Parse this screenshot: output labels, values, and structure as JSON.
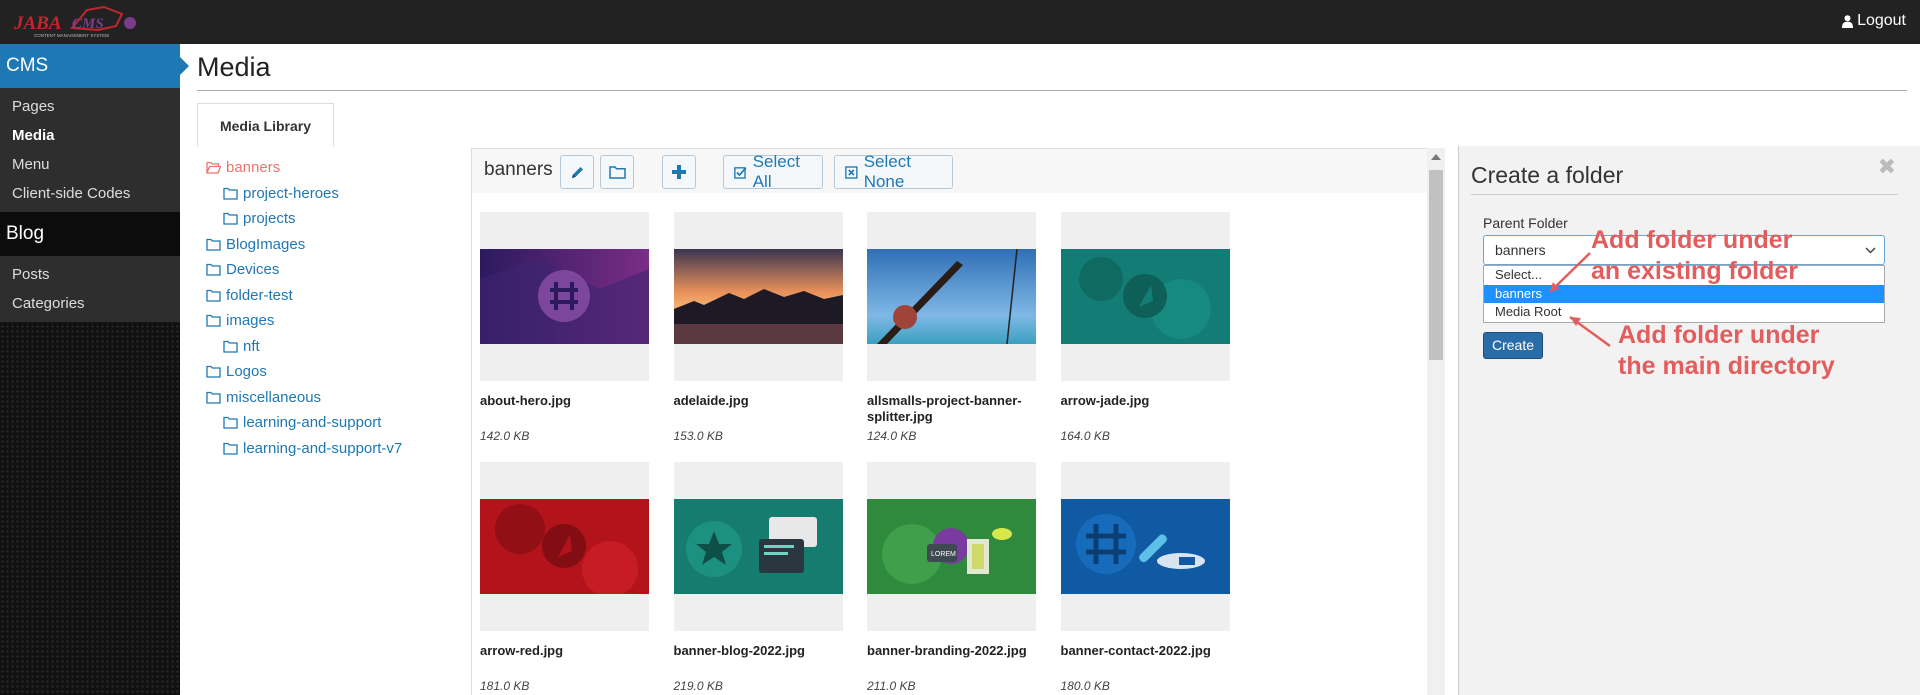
{
  "topbar": {
    "logo_text": "JABA CMS",
    "logo_subtext": "CONTENT MANAGEMENT SYSTEM",
    "logout_label": "Logout"
  },
  "sidebar": {
    "cms_header": "CMS",
    "cms_items": [
      {
        "label": "Pages"
      },
      {
        "label": "Media"
      },
      {
        "label": "Menu"
      },
      {
        "label": "Client-side Codes"
      }
    ],
    "blog_header": "Blog",
    "blog_items": [
      {
        "label": "Posts"
      },
      {
        "label": "Categories"
      }
    ]
  },
  "page": {
    "title": "Media",
    "tab_label": "Media Library"
  },
  "tree": [
    {
      "label": "banners",
      "level": 0,
      "active": true,
      "open": true
    },
    {
      "label": "project-heroes",
      "level": 1
    },
    {
      "label": "projects",
      "level": 1
    },
    {
      "label": "BlogImages",
      "level": 0
    },
    {
      "label": "Devices",
      "level": 0
    },
    {
      "label": "folder-test",
      "level": 0
    },
    {
      "label": "images",
      "level": 0
    },
    {
      "label": "nft",
      "level": 1
    },
    {
      "label": "Logos",
      "level": 0
    },
    {
      "label": "miscellaneous",
      "level": 0
    },
    {
      "label": "learning-and-support",
      "level": 1
    },
    {
      "label": "learning-and-support-v7",
      "level": 1
    }
  ],
  "toolbar": {
    "current_folder": "banners",
    "select_all_label": "Select All",
    "select_none_label": "Select None"
  },
  "files": [
    {
      "name": "about-hero.jpg",
      "size": "142.0 KB"
    },
    {
      "name": "adelaide.jpg",
      "size": "153.0 KB"
    },
    {
      "name": "allsmalls-project-banner-splitter.jpg",
      "size": "124.0 KB"
    },
    {
      "name": "arrow-jade.jpg",
      "size": "164.0 KB"
    },
    {
      "name": "arrow-red.jpg",
      "size": "181.0 KB"
    },
    {
      "name": "banner-blog-2022.jpg",
      "size": "219.0 KB"
    },
    {
      "name": "banner-branding-2022.jpg",
      "size": "211.0 KB"
    },
    {
      "name": "banner-contact-2022.jpg",
      "size": "180.0 KB"
    }
  ],
  "create_folder": {
    "title": "Create a folder",
    "parent_label": "Parent Folder",
    "selected_value": "banners",
    "options": [
      {
        "label": "Select...",
        "selected": false
      },
      {
        "label": "banners",
        "selected": true
      },
      {
        "label": "Media Root",
        "selected": false
      }
    ],
    "create_label": "Create"
  },
  "annotations": {
    "existing_line1": "Add folder under",
    "existing_line2": "an existing folder",
    "root_line1": "Add folder under",
    "root_line2": "the main directory"
  },
  "colors": {
    "accent": "#1e78b4",
    "active_folder": "#e9756e",
    "annotation": "#e25d5d",
    "topbar": "#222222"
  }
}
